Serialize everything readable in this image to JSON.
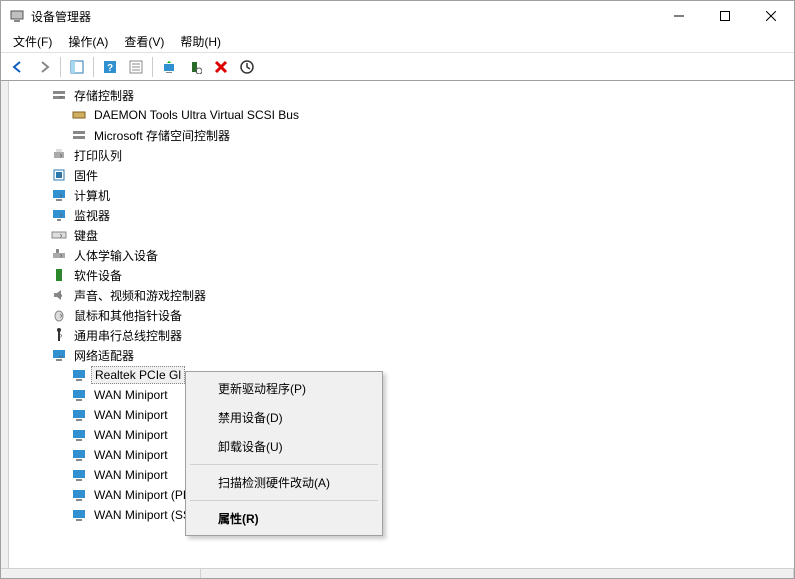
{
  "window": {
    "title": "设备管理器"
  },
  "menu": {
    "file": "文件(F)",
    "action": "操作(A)",
    "view": "查看(V)",
    "help": "帮助(H)"
  },
  "tree": {
    "storage_controllers": "存储控制器",
    "daemon": "DAEMON Tools Ultra Virtual SCSI Bus",
    "ms_storage": "Microsoft 存储空间控制器",
    "print_queues": "打印队列",
    "firmware": "固件",
    "computer": "计算机",
    "monitors": "监视器",
    "keyboards": "键盘",
    "hid": "人体学输入设备",
    "software_devices": "软件设备",
    "audio": "声音、视频和游戏控制器",
    "mouse": "鼠标和其他指针设备",
    "usb": "通用串行总线控制器",
    "net_adapters": "网络适配器",
    "realtek": "Realtek PCIe Gl",
    "wan1": "WAN Miniport",
    "wan2": "WAN Miniport",
    "wan3": "WAN Miniport",
    "wan4": "WAN Miniport",
    "wan5": "WAN Miniport",
    "wan_pptp": "WAN Miniport (PPTP)",
    "wan_sstp": "WAN Miniport (SSTP)"
  },
  "context_menu": {
    "update": "更新驱动程序(P)",
    "disable": "禁用设备(D)",
    "uninstall": "卸载设备(U)",
    "scan": "扫描检测硬件改动(A)",
    "properties": "属性(R)"
  }
}
